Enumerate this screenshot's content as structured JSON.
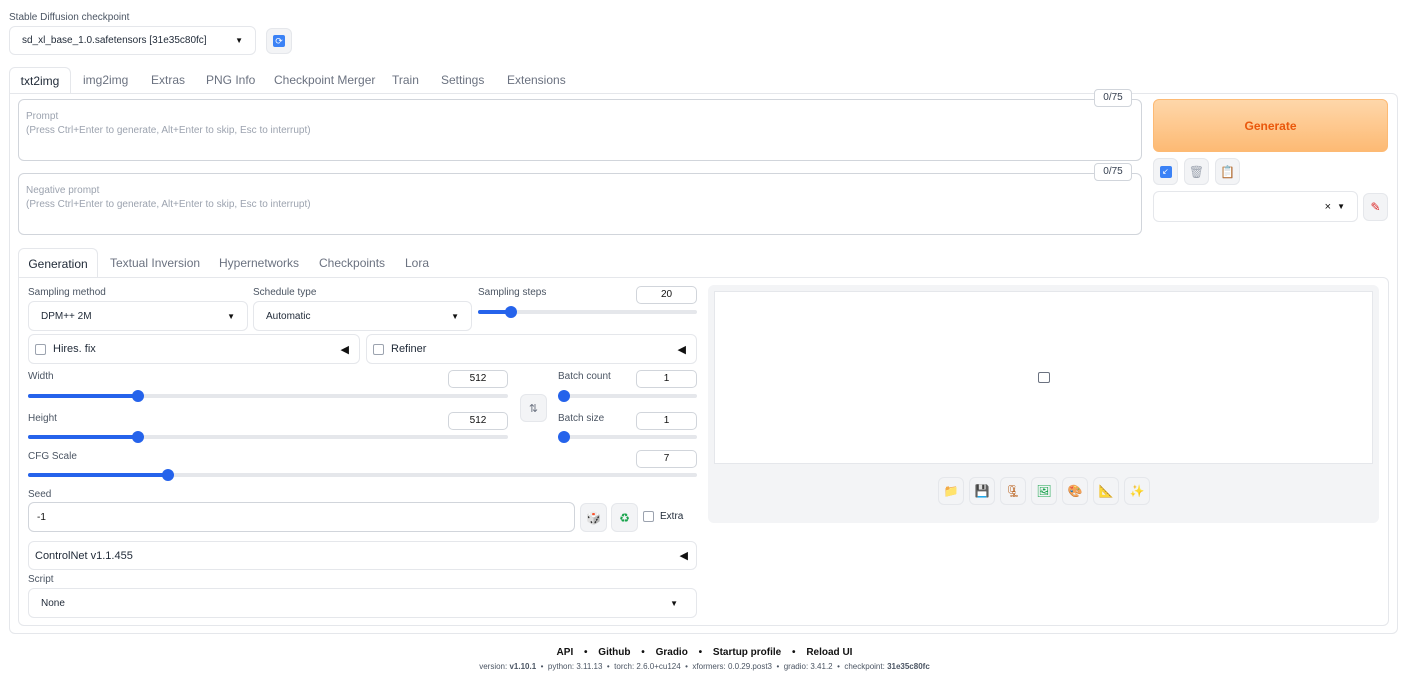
{
  "checkpoint": {
    "label": "Stable Diffusion checkpoint",
    "value": "sd_xl_base_1.0.safetensors [31e35c80fc]"
  },
  "main_tabs": [
    "txt2img",
    "img2img",
    "Extras",
    "PNG Info",
    "Checkpoint Merger",
    "Train",
    "Settings",
    "Extensions"
  ],
  "prompt": {
    "label": "Prompt",
    "placeholder": "(Press Ctrl+Enter to generate, Alt+Enter to skip, Esc to interrupt)",
    "counter": "0/75"
  },
  "negative_prompt": {
    "label": "Negative prompt",
    "placeholder": "(Press Ctrl+Enter to generate, Alt+Enter to skip, Esc to interrupt)",
    "counter": "0/75"
  },
  "generate_label": "Generate",
  "sub_tabs": [
    "Generation",
    "Textual Inversion",
    "Hypernetworks",
    "Checkpoints",
    "Lora"
  ],
  "sampling": {
    "method_label": "Sampling method",
    "method_value": "DPM++ 2M",
    "schedule_label": "Schedule type",
    "schedule_value": "Automatic",
    "steps_label": "Sampling steps",
    "steps_value": "20",
    "steps_fraction": 0.15
  },
  "hires_label": "Hires. fix",
  "refiner_label": "Refiner",
  "width": {
    "label": "Width",
    "value": "512",
    "fraction": 0.23
  },
  "height": {
    "label": "Height",
    "value": "512",
    "fraction": 0.23
  },
  "batch_count": {
    "label": "Batch count",
    "value": "1",
    "fraction": 0.0
  },
  "batch_size": {
    "label": "Batch size",
    "value": "1",
    "fraction": 0.0
  },
  "cfg": {
    "label": "CFG Scale",
    "value": "7",
    "fraction": 0.21
  },
  "seed": {
    "label": "Seed",
    "value": "-1",
    "extra_label": "Extra"
  },
  "controlnet_label": "ControlNet v1.1.455",
  "script": {
    "label": "Script",
    "value": "None"
  },
  "footer": {
    "links": [
      "API",
      "Github",
      "Gradio",
      "Startup profile",
      "Reload UI"
    ],
    "separator": "•",
    "version_label": "version:",
    "version": "v1.10.1",
    "python": "python: 3.11.13",
    "torch": "torch: 2.6.0+cu124",
    "xformers": "xformers: 0.0.29.post3",
    "gradio": "gradio: 3.41.2",
    "checkpoint_label": "checkpoint:",
    "checkpoint": "31e35c80fc"
  },
  "colors": {
    "accent": "#2563eb",
    "generate_bg": "#fdba74",
    "generate_text": "#ea580c"
  }
}
